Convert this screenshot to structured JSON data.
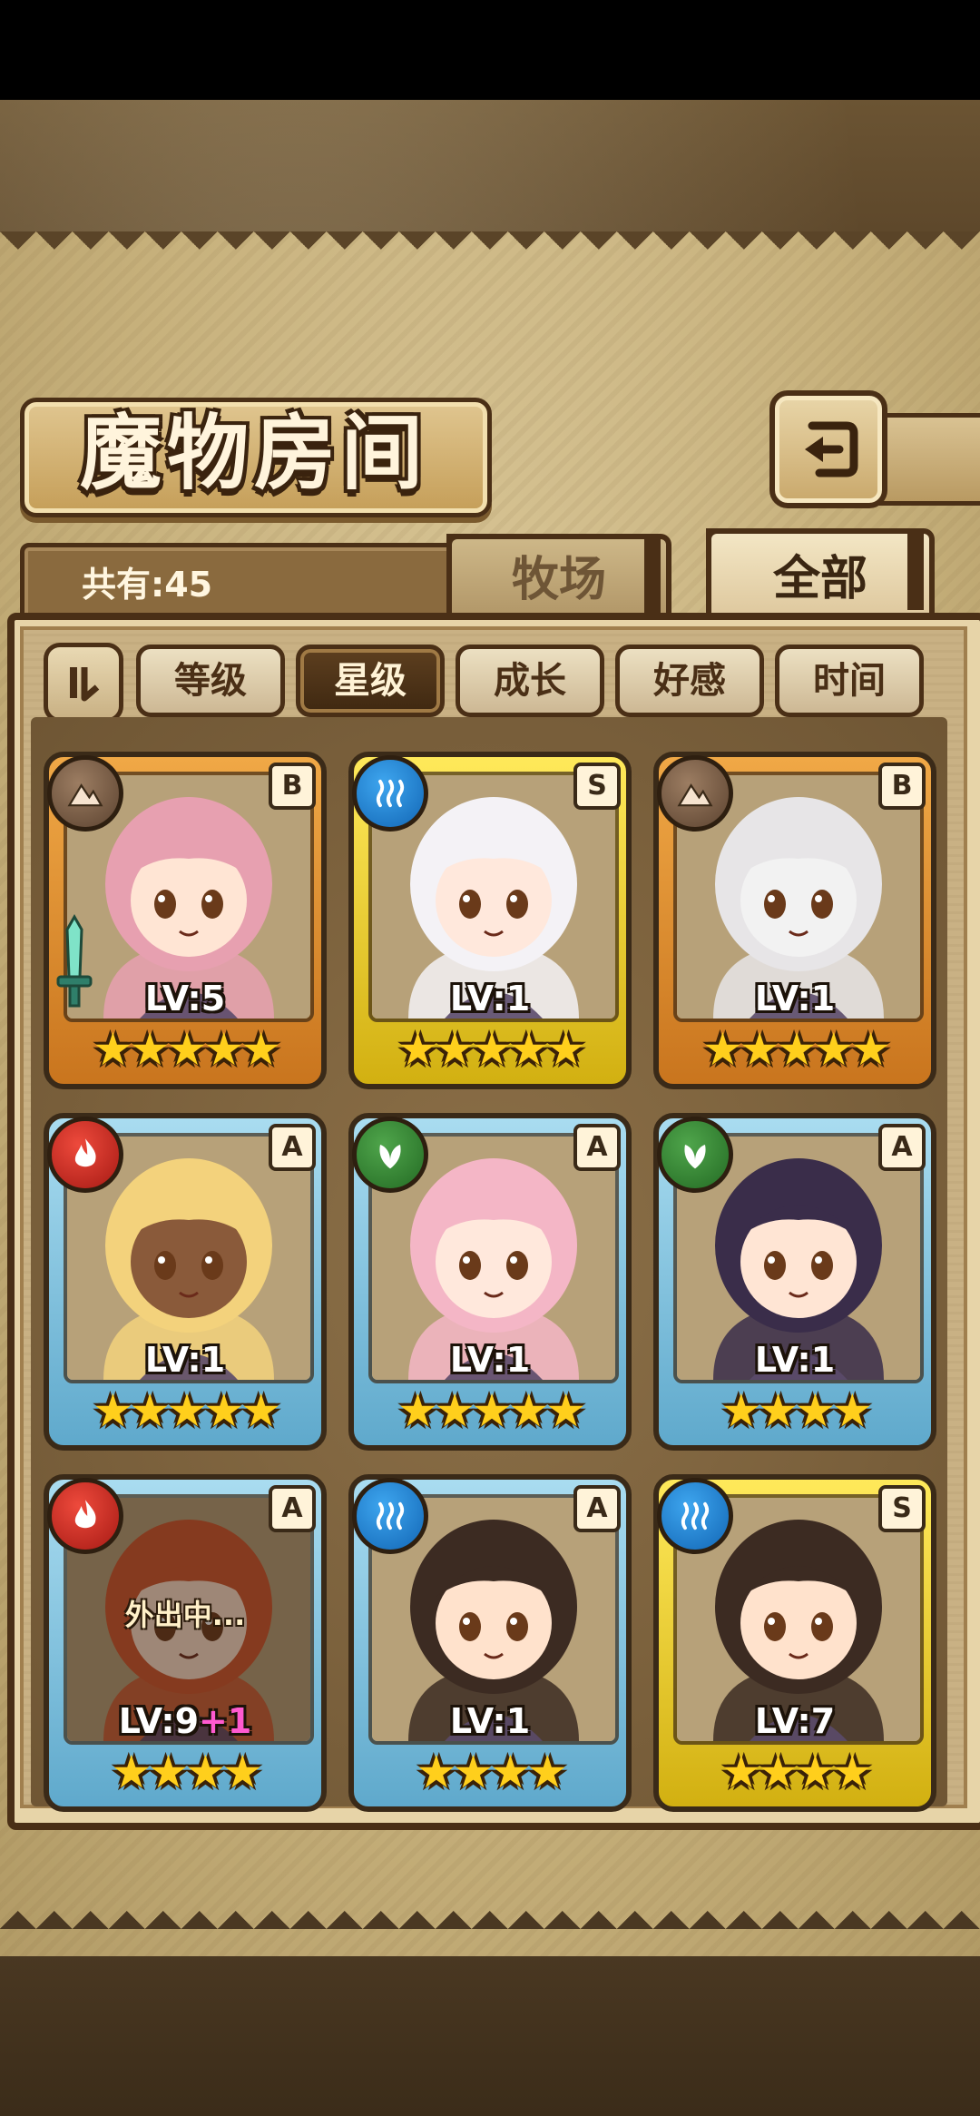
{
  "screen": {
    "title": "魔物房间",
    "count_label": "共有:45",
    "back_icon": "back-arrow-icon"
  },
  "tabs": [
    {
      "label": "牧场",
      "active": false
    },
    {
      "label": "全部",
      "active": true
    }
  ],
  "sort": {
    "toggle_icon": "sort-order-icon",
    "buttons": [
      {
        "label": "等级",
        "active": false
      },
      {
        "label": "星级",
        "active": true
      },
      {
        "label": "成长",
        "active": false
      },
      {
        "label": "好感",
        "active": false
      },
      {
        "label": "时间",
        "active": false
      }
    ]
  },
  "monsters": [
    {
      "element": "earth",
      "rank": "B",
      "level": "LV:5",
      "level_bonus": "",
      "stars": 5,
      "status": "",
      "weapon": true,
      "frame": "B",
      "hair": "#e7a0b0",
      "skin": "#ffe5d4"
    },
    {
      "element": "water",
      "rank": "S",
      "level": "LV:1",
      "level_bonus": "",
      "stars": 5,
      "status": "",
      "weapon": false,
      "frame": "S",
      "hair": "#f4f2f6",
      "skin": "#ffe8dc"
    },
    {
      "element": "earth",
      "rank": "B",
      "level": "LV:1",
      "level_bonus": "",
      "stars": 5,
      "status": "",
      "weapon": false,
      "frame": "B",
      "hair": "#e7e5e7",
      "skin": "#f2f2f2"
    },
    {
      "element": "fire",
      "rank": "A",
      "level": "LV:1",
      "level_bonus": "",
      "stars": 5,
      "status": "",
      "weapon": false,
      "frame": "A",
      "hair": "#f3d27c",
      "skin": "#8a5a3a"
    },
    {
      "element": "wood",
      "rank": "A",
      "level": "LV:1",
      "level_bonus": "",
      "stars": 5,
      "status": "",
      "weapon": false,
      "frame": "A",
      "hair": "#f4b6c6",
      "skin": "#ffe8dc"
    },
    {
      "element": "wood",
      "rank": "A",
      "level": "LV:1",
      "level_bonus": "",
      "stars": 4,
      "status": "",
      "weapon": false,
      "frame": "A",
      "hair": "#3a2d4a",
      "skin": "#ffe5d4"
    },
    {
      "element": "fire",
      "rank": "A",
      "level": "LV:9",
      "level_bonus": "+1",
      "stars": 4,
      "status": "外出中...",
      "weapon": false,
      "frame": "A",
      "hair": "#d2572c",
      "skin": "#ffe2cc"
    },
    {
      "element": "water",
      "rank": "A",
      "level": "LV:1",
      "level_bonus": "",
      "stars": 4,
      "status": "",
      "weapon": false,
      "frame": "A",
      "hair": "#3c2b22",
      "skin": "#ffe2cc"
    },
    {
      "element": "water",
      "rank": "S",
      "level": "LV:7",
      "level_bonus": "",
      "stars": 4,
      "status": "",
      "weapon": false,
      "frame": "S",
      "hair": "#3c2b22",
      "skin": "#ffe2cc"
    }
  ]
}
